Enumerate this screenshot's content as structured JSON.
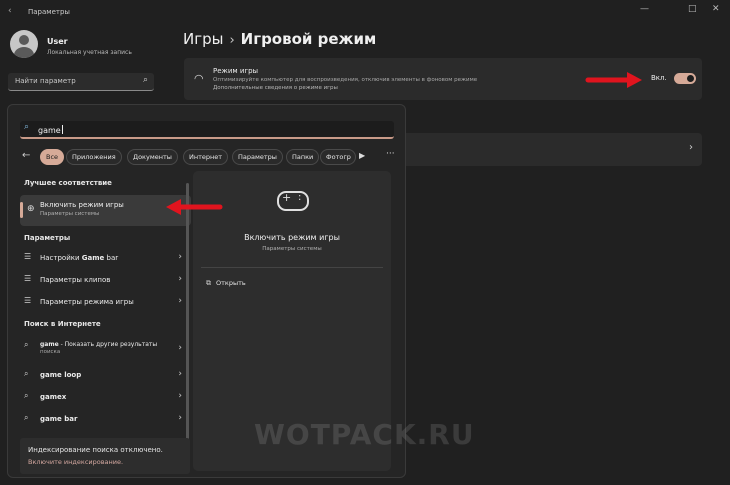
{
  "window": {
    "title": "Параметры",
    "back_glyph": "‹",
    "minimize_glyph": "—",
    "maximize_glyph": "□",
    "close_glyph": "✕"
  },
  "user": {
    "name": "User",
    "account_type": "Локальная учетная запись"
  },
  "settings_search": {
    "placeholder": "Найти параметр",
    "icon": "search-icon"
  },
  "breadcrumb": {
    "parent": "Игры",
    "separator": "›",
    "current": "Игровой режим"
  },
  "game_mode_card": {
    "icon": "gauge-icon",
    "title": "Режим игры",
    "description": "Оптимизируйте компьютер для воспроизведения, отключив элементы в фоновом режиме",
    "link": "Дополнительные сведения о режиме игры",
    "state_label": "Вкл.",
    "toggle_on": true
  },
  "second_card": {
    "chevron": "›"
  },
  "search_flyout": {
    "query": "game",
    "back_glyph": "←",
    "filters": [
      "Все",
      "Приложения",
      "Документы",
      "Интернет",
      "Параметры",
      "Папки",
      "Фотогр"
    ],
    "active_filter": "Все",
    "play_glyph": "▶",
    "more_glyph": "···",
    "best_match_header": "Лучшее соответствие",
    "best_match": {
      "title": "Включить режим игры",
      "subtitle": "Параметры системы"
    },
    "settings_header": "Параметры",
    "settings_items": [
      {
        "prefix": "Настройки ",
        "bold": "Game",
        "suffix": " bar"
      },
      {
        "prefix": "Параметры клипов",
        "bold": "",
        "suffix": ""
      },
      {
        "prefix": "Параметры режима игры",
        "bold": "",
        "suffix": ""
      }
    ],
    "web_header": "Поиск в Интернете",
    "web_items": [
      {
        "bold": "game",
        "suffix": " - Показать другие результаты",
        "desc": "поиска"
      },
      {
        "bold": "game loop",
        "suffix": "",
        "desc": ""
      },
      {
        "bold": "gamex",
        "suffix": "",
        "desc": ""
      },
      {
        "bold": "game bar",
        "suffix": "",
        "desc": ""
      }
    ],
    "index_note": {
      "text": "Индексирование поиска отключено.",
      "link": "Включите индексирование."
    },
    "preview": {
      "title": "Включить режим игры",
      "subtitle": "Параметры системы",
      "open_label": "Открыть",
      "open_icon": "open-external-icon"
    }
  },
  "watermark": "WOTPACK.RU",
  "colors": {
    "accent": "#d6aa98",
    "annotation_red": "#e0141e",
    "background": "#202020",
    "card": "#2b2b2b"
  }
}
